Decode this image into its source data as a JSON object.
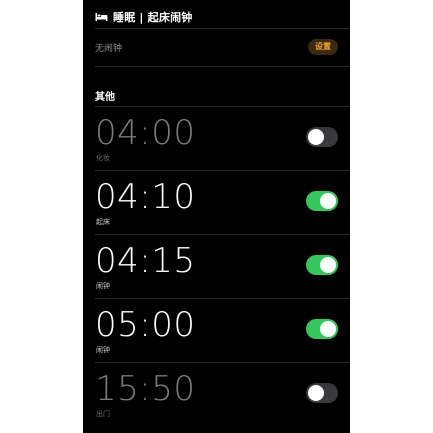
{
  "header": {
    "title": "睡眠 | 起床闹钟",
    "icon": "bed-icon"
  },
  "sleep": {
    "no_alarm_text": "无闹钟",
    "set_button": "设置",
    "set_button_color": "#f5a623"
  },
  "other": {
    "section_title": "其他"
  },
  "alarms": [
    {
      "time": "04:00",
      "label": "化妆",
      "enabled": false
    },
    {
      "time": "04:10",
      "label": "起床",
      "enabled": true
    },
    {
      "time": "04:15",
      "label": "闹钟",
      "enabled": true
    },
    {
      "time": "05:00",
      "label": "闹钟",
      "enabled": true
    },
    {
      "time": "15:50",
      "label": "出门",
      "enabled": false
    }
  ],
  "colors": {
    "background": "#000000",
    "toggle_on": "#34c759",
    "toggle_off": "#39393d"
  }
}
